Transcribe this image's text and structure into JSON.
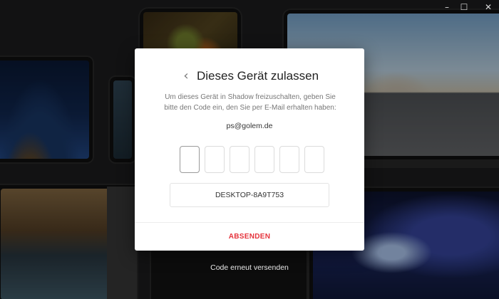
{
  "window_controls": {
    "minimize_glyph": "–",
    "maximize_glyph": "☐",
    "close_glyph": "✕"
  },
  "dialog": {
    "back_glyph": "‹",
    "title": "Dieses Gerät zulassen",
    "description": "Um dieses Gerät in Shadow freizuschalten, geben Sie bitte den Code ein, den Sie per E-Mail erhalten haben:",
    "email": "ps@golem.de",
    "code_digits": [
      "",
      "",
      "",
      "",
      "",
      ""
    ],
    "device_name": "DESKTOP-8A9T753",
    "submit_label": "ABSENDEN"
  },
  "resend_label": "Code erneut versenden",
  "colors": {
    "accent": "#e5323b",
    "background": "#1d1d1f"
  }
}
